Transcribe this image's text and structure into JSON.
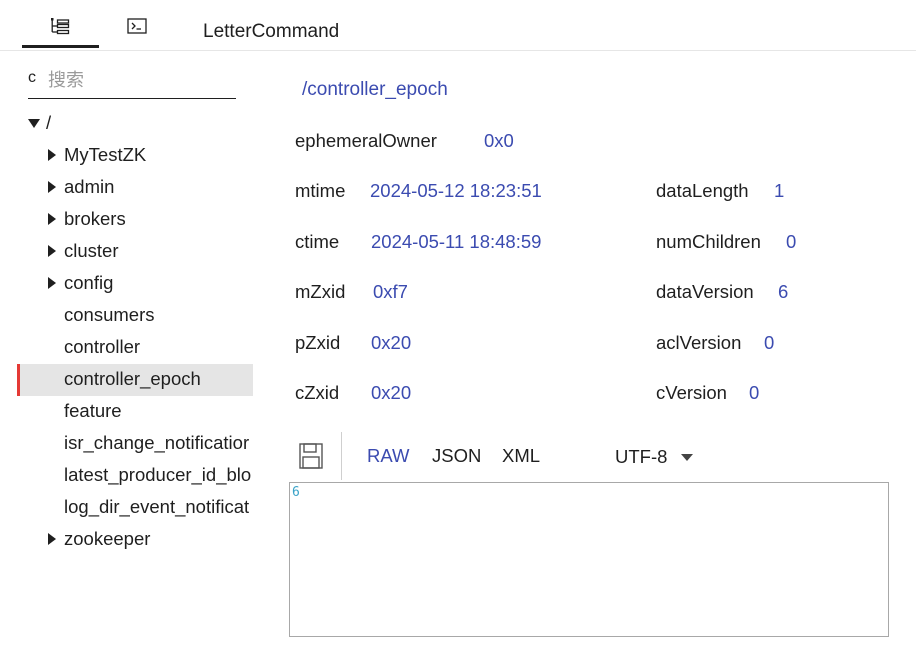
{
  "tabs": {
    "tree_icon": "tree-icon",
    "terminal_icon": "terminal-icon",
    "letter_command": "LetterCommand"
  },
  "search": {
    "icon_glyph": "c",
    "placeholder": "搜索"
  },
  "tree": {
    "root": "/",
    "items": [
      {
        "label": "MyTestZK",
        "expandable": true
      },
      {
        "label": "admin",
        "expandable": true
      },
      {
        "label": "brokers",
        "expandable": true
      },
      {
        "label": "cluster",
        "expandable": true
      },
      {
        "label": "config",
        "expandable": true
      },
      {
        "label": "consumers",
        "expandable": false
      },
      {
        "label": "controller",
        "expandable": false
      },
      {
        "label": "controller_epoch",
        "expandable": false,
        "selected": true
      },
      {
        "label": "feature",
        "expandable": false
      },
      {
        "label": "isr_change_notificatior",
        "expandable": false
      },
      {
        "label": "latest_producer_id_blo",
        "expandable": false
      },
      {
        "label": "log_dir_event_notificat",
        "expandable": false
      },
      {
        "label": "zookeeper",
        "expandable": true
      }
    ]
  },
  "node": {
    "path": "/controller_epoch",
    "ephemeralOwner": {
      "label": "ephemeralOwner",
      "value": "0x0"
    },
    "mtime": {
      "label": "mtime",
      "value": "2024-05-12 18:23:51"
    },
    "ctime": {
      "label": "ctime",
      "value": "2024-05-11 18:48:59"
    },
    "mZxid": {
      "label": "mZxid",
      "value": "0xf7"
    },
    "pZxid": {
      "label": "pZxid",
      "value": "0x20"
    },
    "cZxid": {
      "label": "cZxid",
      "value": "0x20"
    },
    "dataLength": {
      "label": "dataLength",
      "value": "1"
    },
    "numChildren": {
      "label": "numChildren",
      "value": "0"
    },
    "dataVersion": {
      "label": "dataVersion",
      "value": "6"
    },
    "aclVersion": {
      "label": "aclVersion",
      "value": "0"
    },
    "cVersion": {
      "label": "cVersion",
      "value": "0"
    }
  },
  "toolbar": {
    "save_icon": "save-icon",
    "raw": "RAW",
    "json": "JSON",
    "xml": "XML",
    "encoding": "UTF-8"
  },
  "editor": {
    "content": "6"
  },
  "colors": {
    "accent_value": "#3b4bb0",
    "selected_marker": "#e53935",
    "selected_bg": "#e5e5e5",
    "editor_text": "#3aa3c8"
  }
}
